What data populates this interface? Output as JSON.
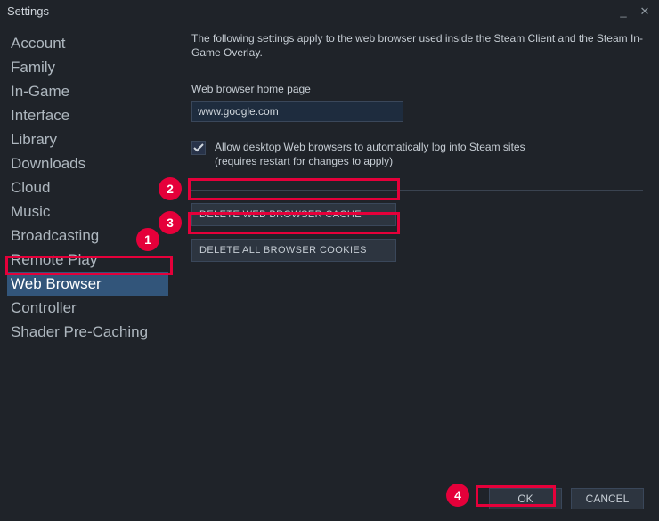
{
  "window": {
    "title": "Settings"
  },
  "sidebar": {
    "items": [
      {
        "label": "Account"
      },
      {
        "label": "Family"
      },
      {
        "label": "In-Game"
      },
      {
        "label": "Interface"
      },
      {
        "label": "Library"
      },
      {
        "label": "Downloads"
      },
      {
        "label": "Cloud"
      },
      {
        "label": "Music"
      },
      {
        "label": "Broadcasting"
      },
      {
        "label": "Remote Play"
      },
      {
        "label": "Web Browser"
      },
      {
        "label": "Controller"
      },
      {
        "label": "Shader Pre-Caching"
      }
    ],
    "selected_index": 10
  },
  "main": {
    "description": "The following settings apply to the web browser used inside the Steam Client and the Steam In-Game Overlay.",
    "homepage_label": "Web browser home page",
    "homepage_value": "www.google.com",
    "autologin_label": "Allow desktop Web browsers to automatically log into Steam sites",
    "autologin_note": "(requires restart for changes to apply)",
    "delete_cache_label": "DELETE WEB BROWSER CACHE",
    "delete_cookies_label": "DELETE ALL BROWSER COOKIES"
  },
  "footer": {
    "ok_label": "OK",
    "cancel_label": "CANCEL"
  },
  "annotations": {
    "n1": "1",
    "n2": "2",
    "n3": "3",
    "n4": "4"
  }
}
